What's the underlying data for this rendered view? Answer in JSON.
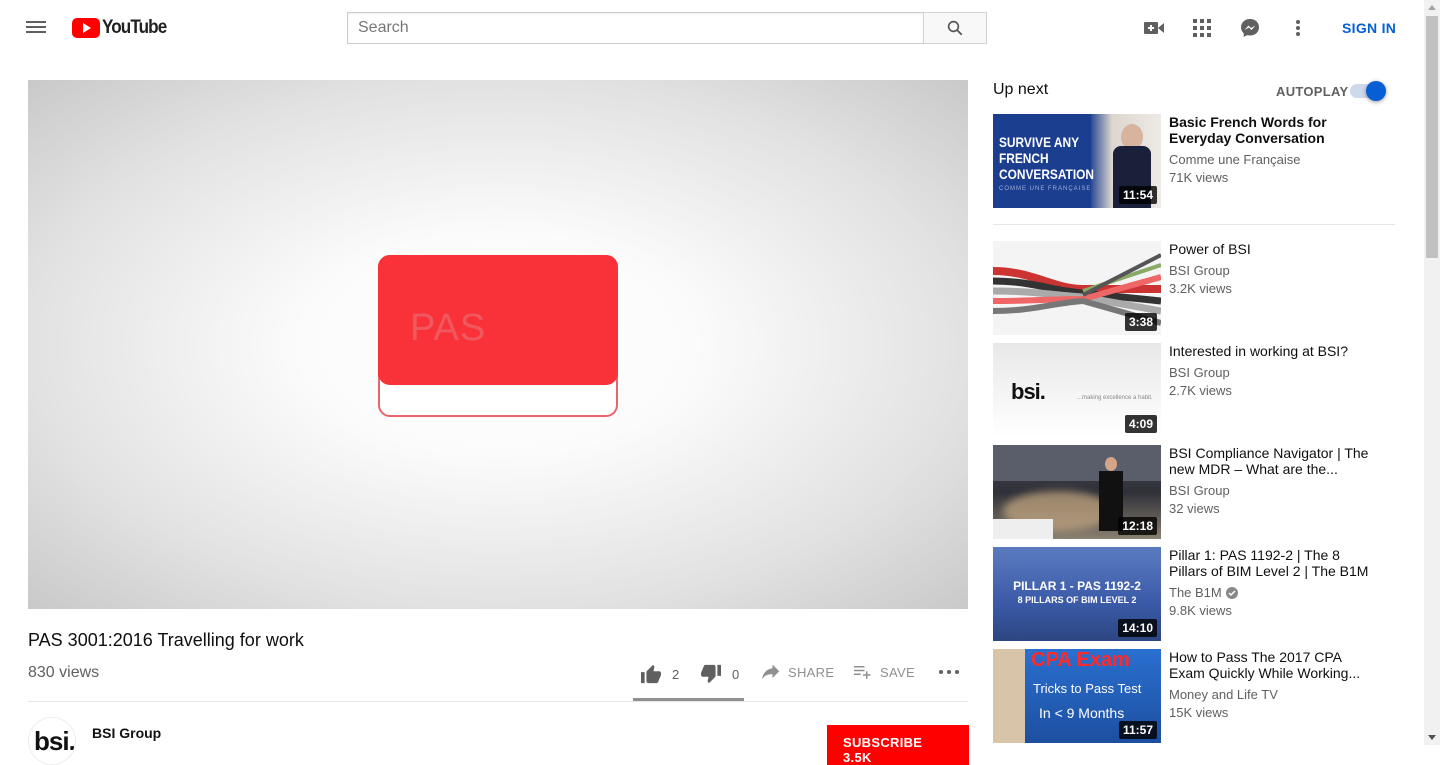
{
  "header": {
    "logo_text": "YouTube",
    "search_placeholder": "Search",
    "sign_in": "SIGN IN"
  },
  "video": {
    "player_text": "PAS",
    "title": "PAS 3001:2016 Travelling for work",
    "views": "830 views",
    "likes": "2",
    "dislikes": "0",
    "share_label": "SHARE",
    "save_label": "SAVE",
    "like_ratio": 1.0
  },
  "channel": {
    "avatar_text": "bsi.",
    "name": "BSI Group",
    "subscribe_label": "SUBSCRIBE  3.5K"
  },
  "sidebar": {
    "up_next": "Up next",
    "autoplay": "AUTOPLAY",
    "autoplay_on": true,
    "items": [
      {
        "title": "Basic French Words for Everyday Conversation",
        "channel": "Comme une Française",
        "views": "71K views",
        "duration": "11:54",
        "thumb_text": "SURVIVE ANY FRENCH CONVERSATION",
        "thumb_sub": "COMME UNE FRANÇAISE",
        "verified": false
      },
      {
        "title": "Power of BSI",
        "channel": "BSI Group",
        "views": "3.2K views",
        "duration": "3:38",
        "verified": false
      },
      {
        "title": "Interested in working at BSI?",
        "channel": "BSI Group",
        "views": "2.7K views",
        "duration": "4:09",
        "thumb_logo": "bsi.",
        "thumb_tag": "...making excellence a habit.",
        "verified": false
      },
      {
        "title": "BSI Compliance Navigator | The new MDR – What are the...",
        "channel": "BSI Group",
        "views": "32 views",
        "duration": "12:18",
        "verified": false
      },
      {
        "title": "Pillar 1: PAS 1192-2 | The 8 Pillars of BIM Level 2 | The B1M",
        "channel": "The B1M",
        "views": "9.8K views",
        "duration": "14:10",
        "thumb_text": "PILLAR 1 - PAS 1192-2",
        "thumb_sub": "8 PILLARS OF BIM LEVEL 2",
        "verified": true
      },
      {
        "title": "How to Pass The 2017 CPA Exam Quickly While Working...",
        "channel": "Money and Life TV",
        "views": "15K views",
        "duration": "11:57",
        "thumb_text": "CPA Exam",
        "thumb_sub": "Tricks to Pass Test",
        "thumb_sub2": "In < 9 Months",
        "verified": false
      }
    ]
  },
  "colors": {
    "brand_red": "#ff0000",
    "link_blue": "#065fd4",
    "pas_red": "#f9323a"
  }
}
